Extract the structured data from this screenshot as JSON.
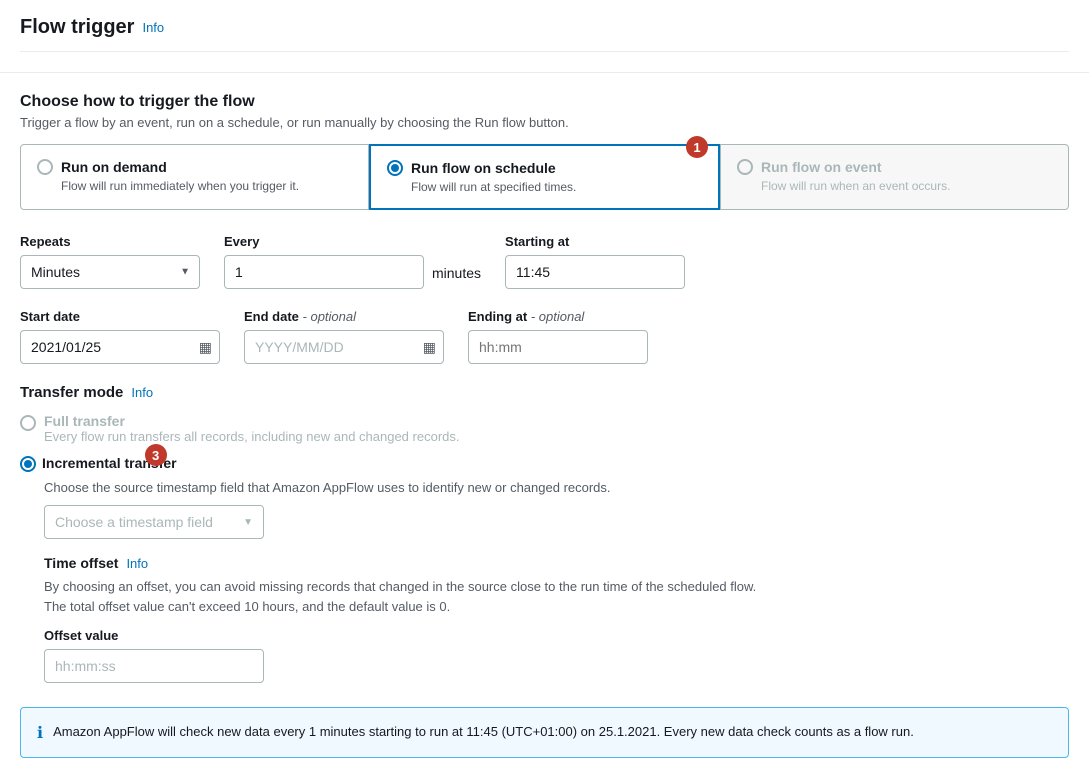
{
  "header": {
    "title": "Flow trigger",
    "info_link": "Info"
  },
  "trigger_section": {
    "title": "Choose how to trigger the flow",
    "description": "Trigger a flow by an event, run on a schedule, or run manually by choosing the Run flow button."
  },
  "trigger_options": [
    {
      "id": "on_demand",
      "title": "Run on demand",
      "description": "Flow will run immediately when you trigger it.",
      "selected": false,
      "disabled": false,
      "badge": null
    },
    {
      "id": "on_schedule",
      "title": "Run flow on schedule",
      "description": "Flow will run at specified times.",
      "selected": true,
      "disabled": false,
      "badge": "1"
    },
    {
      "id": "on_event",
      "title": "Run flow on event",
      "description": "Flow will run when an event occurs.",
      "selected": false,
      "disabled": true,
      "badge": null
    }
  ],
  "schedule": {
    "repeats_label": "Repeats",
    "repeats_value": "Minutes",
    "every_label": "Every",
    "every_value": "1",
    "minutes_suffix": "minutes",
    "starting_at_label": "Starting at",
    "starting_at_value": "11:45",
    "start_date_label": "Start date",
    "start_date_value": "2021/01/25",
    "end_date_label": "End date",
    "end_date_optional": "- optional",
    "end_date_placeholder": "YYYY/MM/DD",
    "ending_at_label": "Ending at",
    "ending_at_optional": "- optional",
    "ending_at_placeholder": "hh:mm"
  },
  "transfer_mode": {
    "title": "Transfer mode",
    "info_link": "Info",
    "badge": null,
    "full_transfer": {
      "title": "Full transfer",
      "description": "Every flow run transfers all records, including new and changed records.",
      "selected": false
    },
    "incremental_transfer": {
      "title": "Incremental transfer",
      "description": "Choose the source timestamp field that Amazon AppFlow uses to identify new or changed records.",
      "selected": true,
      "badge": "3"
    }
  },
  "timestamp_field": {
    "label": "Choose a timestamp field",
    "placeholder": "Choose a timestamp field"
  },
  "time_offset": {
    "title": "Time offset",
    "info_link": "Info",
    "description_line1": "By choosing an offset, you can avoid missing records that changed in the source close to the run time of the scheduled flow.",
    "description_line2": "The total offset value can't exceed 10 hours, and the default value is 0.",
    "offset_label": "Offset value",
    "offset_placeholder": "hh:mm:ss"
  },
  "info_banner": {
    "text": "Amazon AppFlow will check new data every 1 minutes starting to run at 11:45 (UTC+01:00) on 25.1.2021. Every new data check counts as a flow run."
  },
  "icons": {
    "info": "ℹ",
    "calendar": "▦",
    "chevron_down": "▼"
  }
}
